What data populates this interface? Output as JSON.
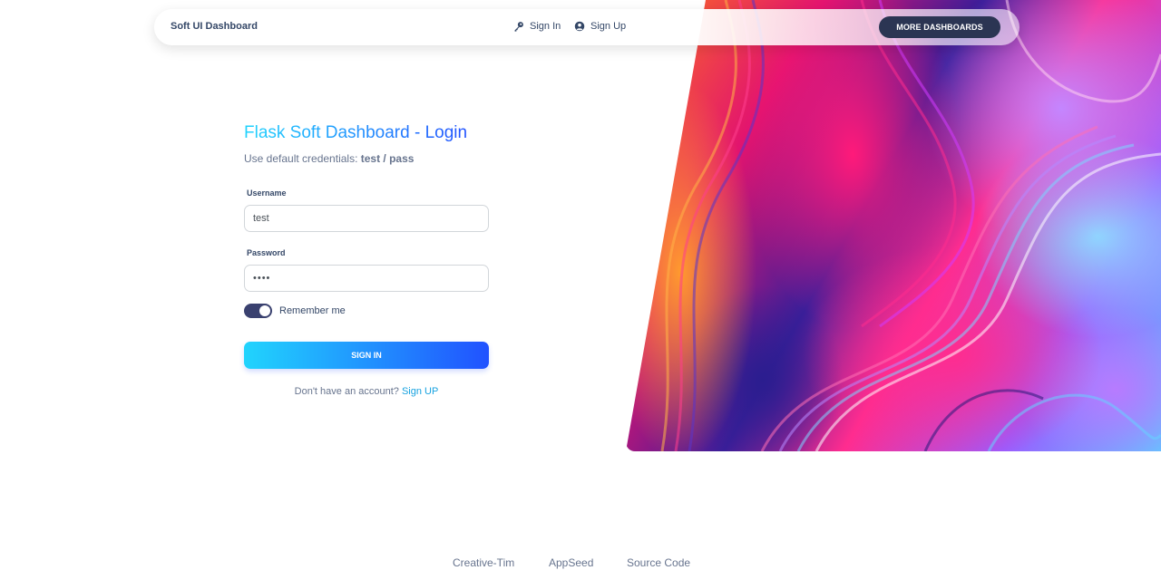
{
  "navbar": {
    "brand": "Soft UI Dashboard",
    "sign_in": "Sign In",
    "sign_up": "Sign Up",
    "more_dashboards": "MORE DASHBOARDS"
  },
  "login": {
    "title": "Flask Soft Dashboard - Login",
    "subtitle_prefix": "Use default credentials:",
    "subtitle_credentials": "test / pass",
    "username_label": "Username",
    "username_value": "test",
    "password_label": "Password",
    "password_value": "••••",
    "remember_label": "Remember me",
    "remember_checked": true,
    "submit_label": "SIGN IN",
    "no_account_text": "Don't have an account?",
    "signup_link": "Sign UP"
  },
  "footer": {
    "links": [
      "Creative-Tim",
      "AppSeed",
      "Source Code"
    ]
  },
  "colors": {
    "accent_start": "#21d4fd",
    "accent_end": "#2152ff",
    "dark_button": "#2b3553",
    "toggle_on": "#3a416f"
  }
}
